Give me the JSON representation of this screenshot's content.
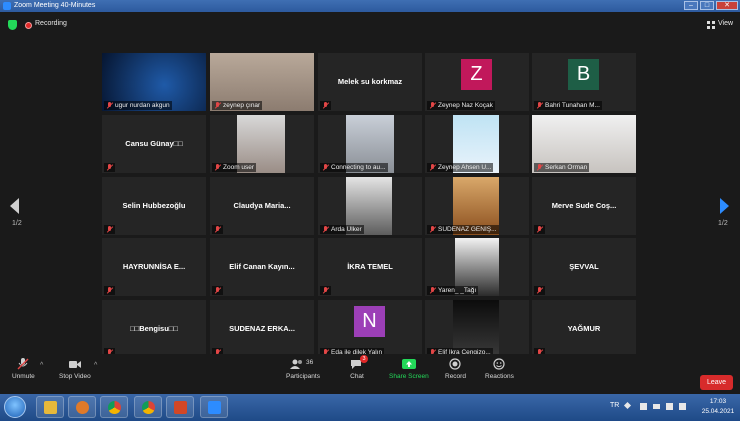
{
  "window": {
    "title": "Zoom Meeting 40-Minutes"
  },
  "topbar": {
    "recording_label": "Recording",
    "view_label": "View"
  },
  "gallery": {
    "page_left": "1/2",
    "page_right": "1/2",
    "tiles": [
      {
        "name": "ugur nurdan akgun",
        "type": "video",
        "active": true
      },
      {
        "name": "zeynep çınar",
        "type": "video"
      },
      {
        "name": "",
        "display": "Melek su korkmaz",
        "type": "text"
      },
      {
        "name": "Zeynep Naz Koçak",
        "type": "avatar",
        "letter": "Z",
        "color": "#c1185b"
      },
      {
        "name": "Bahri Tunahan M...",
        "type": "avatar",
        "letter": "B",
        "color": "#1e5e46"
      },
      {
        "name": "",
        "display": "Cansu Günay□□",
        "type": "text"
      },
      {
        "name": "Zoom user",
        "type": "video"
      },
      {
        "name": "Connecting to au...",
        "type": "video"
      },
      {
        "name": "Zeynep Ahsen U...",
        "type": "video"
      },
      {
        "name": "Serkan Orman",
        "type": "video"
      },
      {
        "name": "",
        "display": "Selin Hubbezoğlu",
        "type": "text"
      },
      {
        "name": "",
        "display": "Claudya Maria...",
        "type": "text"
      },
      {
        "name": "Arda Ülker",
        "type": "video"
      },
      {
        "name": "SUDENAZ GENİŞ...",
        "type": "video"
      },
      {
        "name": "",
        "display": "Merve Sude Coş...",
        "type": "text"
      },
      {
        "name": "",
        "display": "HAYRUNNİSA E...",
        "type": "text"
      },
      {
        "name": "",
        "display": "Elif Canan Kayın...",
        "type": "text"
      },
      {
        "name": "",
        "display": "İKRA TEMEL",
        "type": "text"
      },
      {
        "name": "Yaren_ _Tağı",
        "type": "video"
      },
      {
        "name": "",
        "display": "ŞEVVAL",
        "type": "text"
      },
      {
        "name": "",
        "display": "□□Bengisu□□",
        "type": "text"
      },
      {
        "name": "",
        "display": "SUDENAZ ERKA...",
        "type": "text"
      },
      {
        "name": "Eda ile dilek Yalın",
        "type": "avatar",
        "letter": "N",
        "color": "#9c3fb7"
      },
      {
        "name": "Elif İkra Cengizo...",
        "type": "video"
      },
      {
        "name": "",
        "display": "YAĞMUR",
        "type": "text"
      }
    ]
  },
  "toolbar": {
    "unmute": "Unmute",
    "stop_video": "Stop Video",
    "participants": "Participants",
    "participants_count": "36",
    "chat": "Chat",
    "chat_badge": "3",
    "share_screen": "Share Screen",
    "record": "Record",
    "reactions": "Reactions",
    "leave": "Leave"
  },
  "taskbar": {
    "language": "TR",
    "time": "17:03",
    "date": "25.04.2021"
  },
  "colors": {
    "zoom_bg": "#1a1a1a",
    "tile_bg": "#252525",
    "share_green": "#23d959",
    "leave_red": "#d72b2b",
    "active_border": "#dce34a"
  }
}
